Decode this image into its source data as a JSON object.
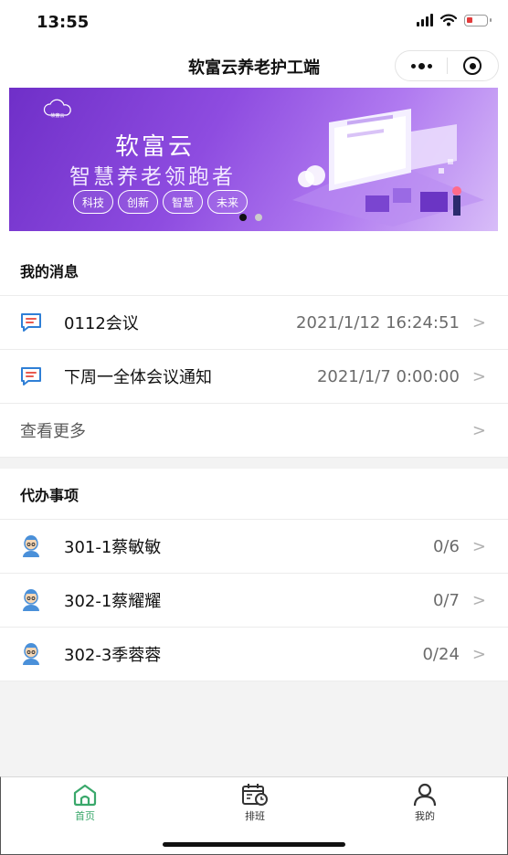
{
  "status": {
    "time": "13:55"
  },
  "nav": {
    "title": "软富云养老护工端"
  },
  "banner": {
    "logo_text": "软富云",
    "brand": "软富云",
    "slogan": "智慧养老领跑者",
    "tags": [
      "科技",
      "创新",
      "智慧",
      "未来"
    ],
    "slides_total": 2,
    "active_slide": 1
  },
  "messages": {
    "title": "我的消息",
    "items": [
      {
        "title": "0112会议",
        "time": "2021/1/12 16:24:51"
      },
      {
        "title": "下周一全体会议通知",
        "time": "2021/1/7 0:00:00"
      }
    ],
    "more_label": "查看更多"
  },
  "todo": {
    "title": "代办事项",
    "items": [
      {
        "name": "301-1蔡敏敏",
        "count": "0/6"
      },
      {
        "name": "302-1蔡耀耀",
        "count": "0/7"
      },
      {
        "name": "302-3季蓉蓉",
        "count": "0/24"
      }
    ]
  },
  "tabs": [
    {
      "label": "首页",
      "icon": "home-icon",
      "active": true
    },
    {
      "label": "排班",
      "icon": "calendar-clock-icon",
      "active": false
    },
    {
      "label": "我的",
      "icon": "user-icon",
      "active": false
    }
  ],
  "colors": {
    "accent": "#3aa86b",
    "message_icon": "#2f7fd6",
    "banner": "#8e4ce0"
  }
}
